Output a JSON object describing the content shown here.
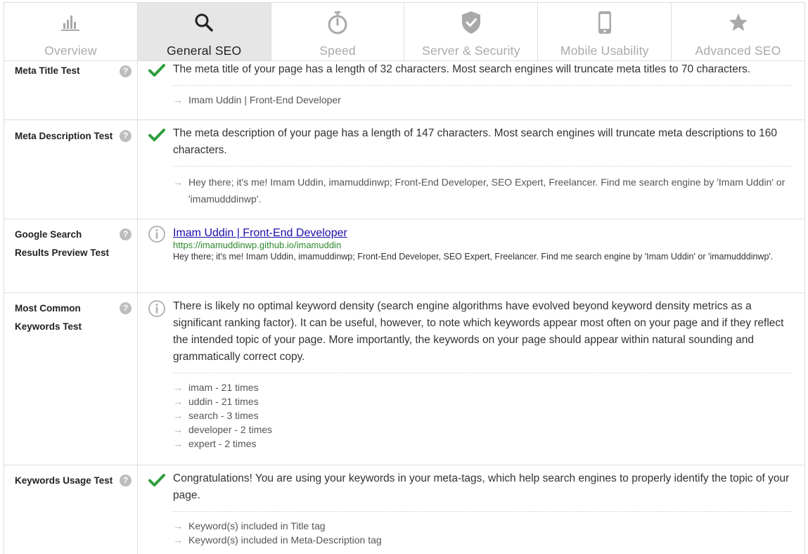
{
  "tabs": [
    {
      "label": "Overview",
      "icon": "bar-chart-icon",
      "active": false
    },
    {
      "label": "General SEO",
      "icon": "search-icon",
      "active": true
    },
    {
      "label": "Speed",
      "icon": "stopwatch-icon",
      "active": false
    },
    {
      "label": "Server & Security",
      "icon": "shield-check-icon",
      "active": false
    },
    {
      "label": "Mobile Usability",
      "icon": "mobile-phone-icon",
      "active": false
    },
    {
      "label": "Advanced SEO",
      "icon": "star-icon",
      "active": false
    }
  ],
  "help_glyph": "?",
  "arrow_glyph": "→",
  "rows": {
    "meta_title": {
      "name": "Meta Title Test",
      "status": "pass",
      "message": "The meta title of your page has a length of 32 characters. Most search engines will truncate meta titles to 70 characters.",
      "items": [
        "Imam Uddin | Front-End Developer"
      ]
    },
    "meta_description": {
      "name": "Meta Description Test",
      "status": "pass",
      "message": "The meta description of your page has a length of 147 characters. Most search engines will truncate meta descriptions to 160 characters.",
      "items": [
        "Hey there; it's me! Imam Uddin, imamuddinwp; Front-End Developer, SEO Expert, Freelancer. Find me search engine by 'Imam Uddin' or 'imamudddinwp'."
      ]
    },
    "google_preview": {
      "name": "Google Search Results Preview Test",
      "status": "info",
      "title": "Imam Uddin | Front-End Developer",
      "url": "https://imamuddinwp.github.io/imamuddin",
      "description": "Hey there; it's me! Imam Uddin, imamuddinwp; Front-End Developer, SEO Expert, Freelancer. Find me search engine by 'Imam Uddin' or 'imamudddinwp'."
    },
    "keywords": {
      "name": "Most Common Keywords Test",
      "status": "info",
      "message": "There is likely no optimal keyword density (search engine algorithms have evolved beyond keyword density metrics as a significant ranking factor). It can be useful, however, to note which keywords appear most often on your page and if they reflect the intended topic of your page. More importantly, the keywords on your page should appear within natural sounding and grammatically correct copy.",
      "items": [
        "imam - 21 times",
        "uddin - 21 times",
        "search - 3 times",
        "developer - 2 times",
        "expert - 2 times"
      ]
    },
    "keywords_usage": {
      "name": "Keywords Usage Test",
      "status": "pass",
      "message": "Congratulations! You are using your keywords in your meta-tags, which help search engines to properly identify the topic of your page.",
      "items": [
        "Keyword(s) included in Title tag",
        "Keyword(s) included in Meta-Description tag"
      ]
    }
  },
  "colors": {
    "pass_green": "#2e9e3e",
    "info_gray": "#b5b5b5",
    "tab_icon_gray": "#a9a9a9",
    "tab_icon_active": "#222222",
    "link_blue": "#1a0dab",
    "url_green": "#2d8a2d"
  }
}
